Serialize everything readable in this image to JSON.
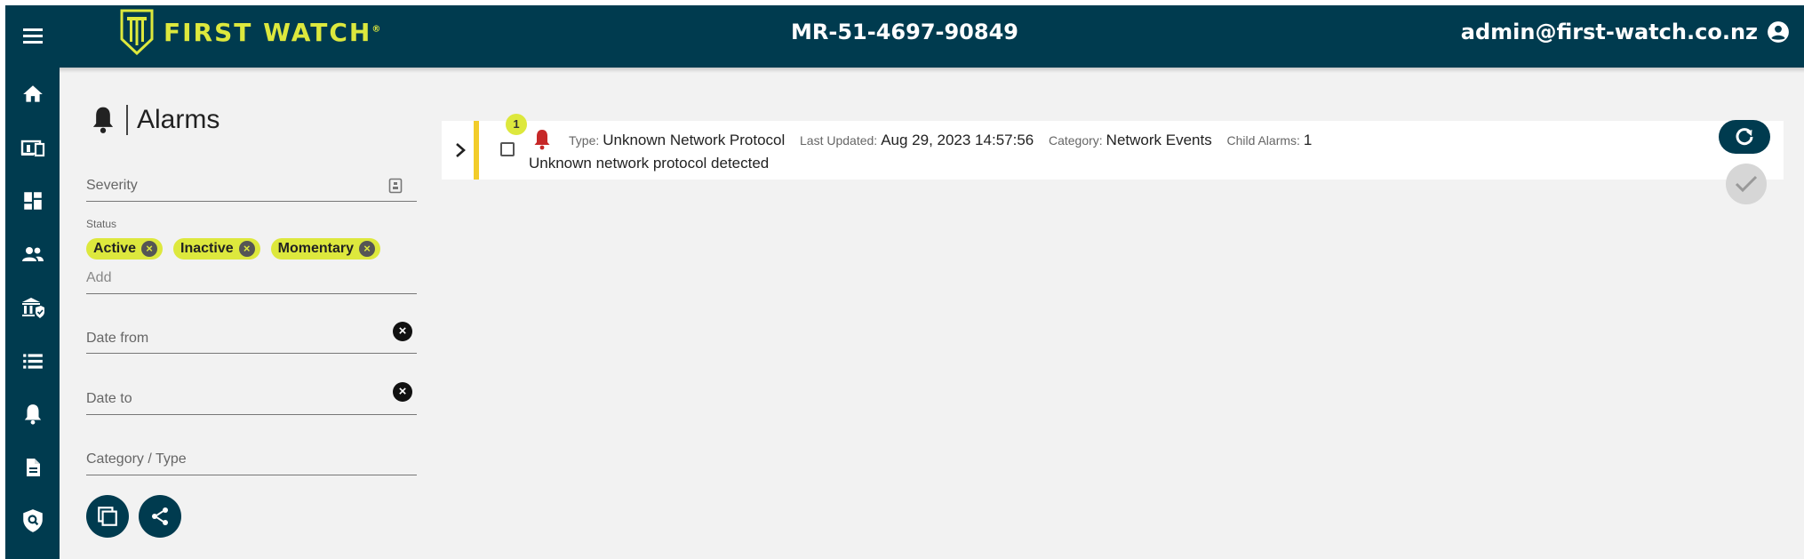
{
  "header": {
    "logo_text": "FIRST WATCH",
    "logo_mark": "®",
    "device_id": "MR-51-4697-90849",
    "user_email": "admin@first-watch.co.nz"
  },
  "sidebar": {
    "items": [
      {
        "name": "home-icon"
      },
      {
        "name": "devices-icon"
      },
      {
        "name": "dashboard-icon"
      },
      {
        "name": "users-icon"
      },
      {
        "name": "institution-icon"
      },
      {
        "name": "list-icon"
      },
      {
        "name": "bell-icon"
      },
      {
        "name": "document-icon"
      },
      {
        "name": "security-search-icon"
      }
    ]
  },
  "page": {
    "title": "Alarms"
  },
  "filters": {
    "severity_label": "Severity",
    "status_label": "Status",
    "status_chips": [
      "Active",
      "Inactive",
      "Momentary"
    ],
    "add_placeholder": "Add",
    "date_from_label": "Date from",
    "date_to_label": "Date to",
    "category_label": "Category / Type"
  },
  "alarm": {
    "count": "1",
    "type_key": "Type:",
    "type_value": "Unknown Network Protocol",
    "updated_key": "Last Updated:",
    "updated_value": "Aug 29, 2023 14:57:56",
    "category_key": "Category:",
    "category_value": "Network Events",
    "child_key": "Child Alarms:",
    "child_value": "1",
    "description": "Unknown network protocol detected"
  },
  "colors": {
    "primary": "#003b4f",
    "accent": "#dde83d",
    "alarm_red": "#c62828",
    "alarm_bar": "#f2cc2a"
  }
}
